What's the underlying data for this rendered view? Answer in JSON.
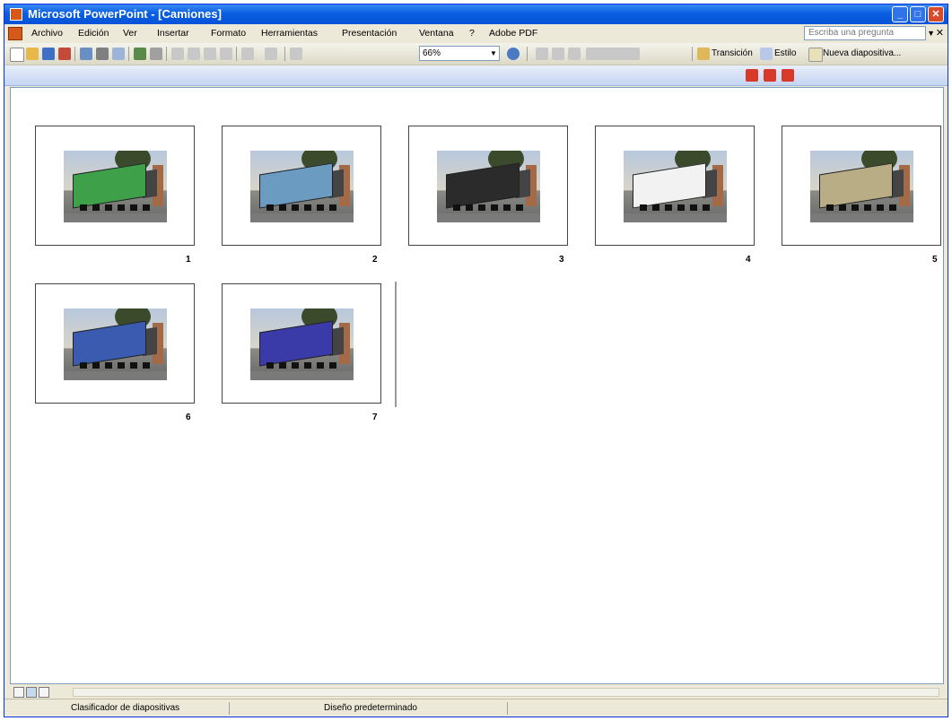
{
  "window": {
    "title": "Microsoft PowerPoint - [Camiones]"
  },
  "menu": [
    {
      "label": "Archivo"
    },
    {
      "label": "Edición"
    },
    {
      "label": "Ver"
    },
    {
      "label": "Insertar"
    },
    {
      "label": "Formato"
    },
    {
      "label": "Herramientas"
    },
    {
      "label": "Presentación"
    },
    {
      "label": "Ventana"
    },
    {
      "label": "?"
    },
    {
      "label": "Adobe PDF"
    }
  ],
  "ask_placeholder": "Escriba una pregunta",
  "toolbar": {
    "zoom": "66%",
    "transition_label": "Transición",
    "style_label": "Estilo",
    "new_slide_label": "Nueva diapositiva..."
  },
  "slides": [
    {
      "number": "1",
      "color": "#3fa04a"
    },
    {
      "number": "2",
      "color": "#6c9bc2"
    },
    {
      "number": "3",
      "color": "#2b2b2b"
    },
    {
      "number": "4",
      "color": "#f2f2f2"
    },
    {
      "number": "5",
      "color": "#b8ad84"
    },
    {
      "number": "6",
      "color": "#3a5bb0"
    },
    {
      "number": "7",
      "color": "#3a3aa8"
    }
  ],
  "status": {
    "view": "Clasificador de diapositivas",
    "design": "Diseño predeterminado"
  }
}
